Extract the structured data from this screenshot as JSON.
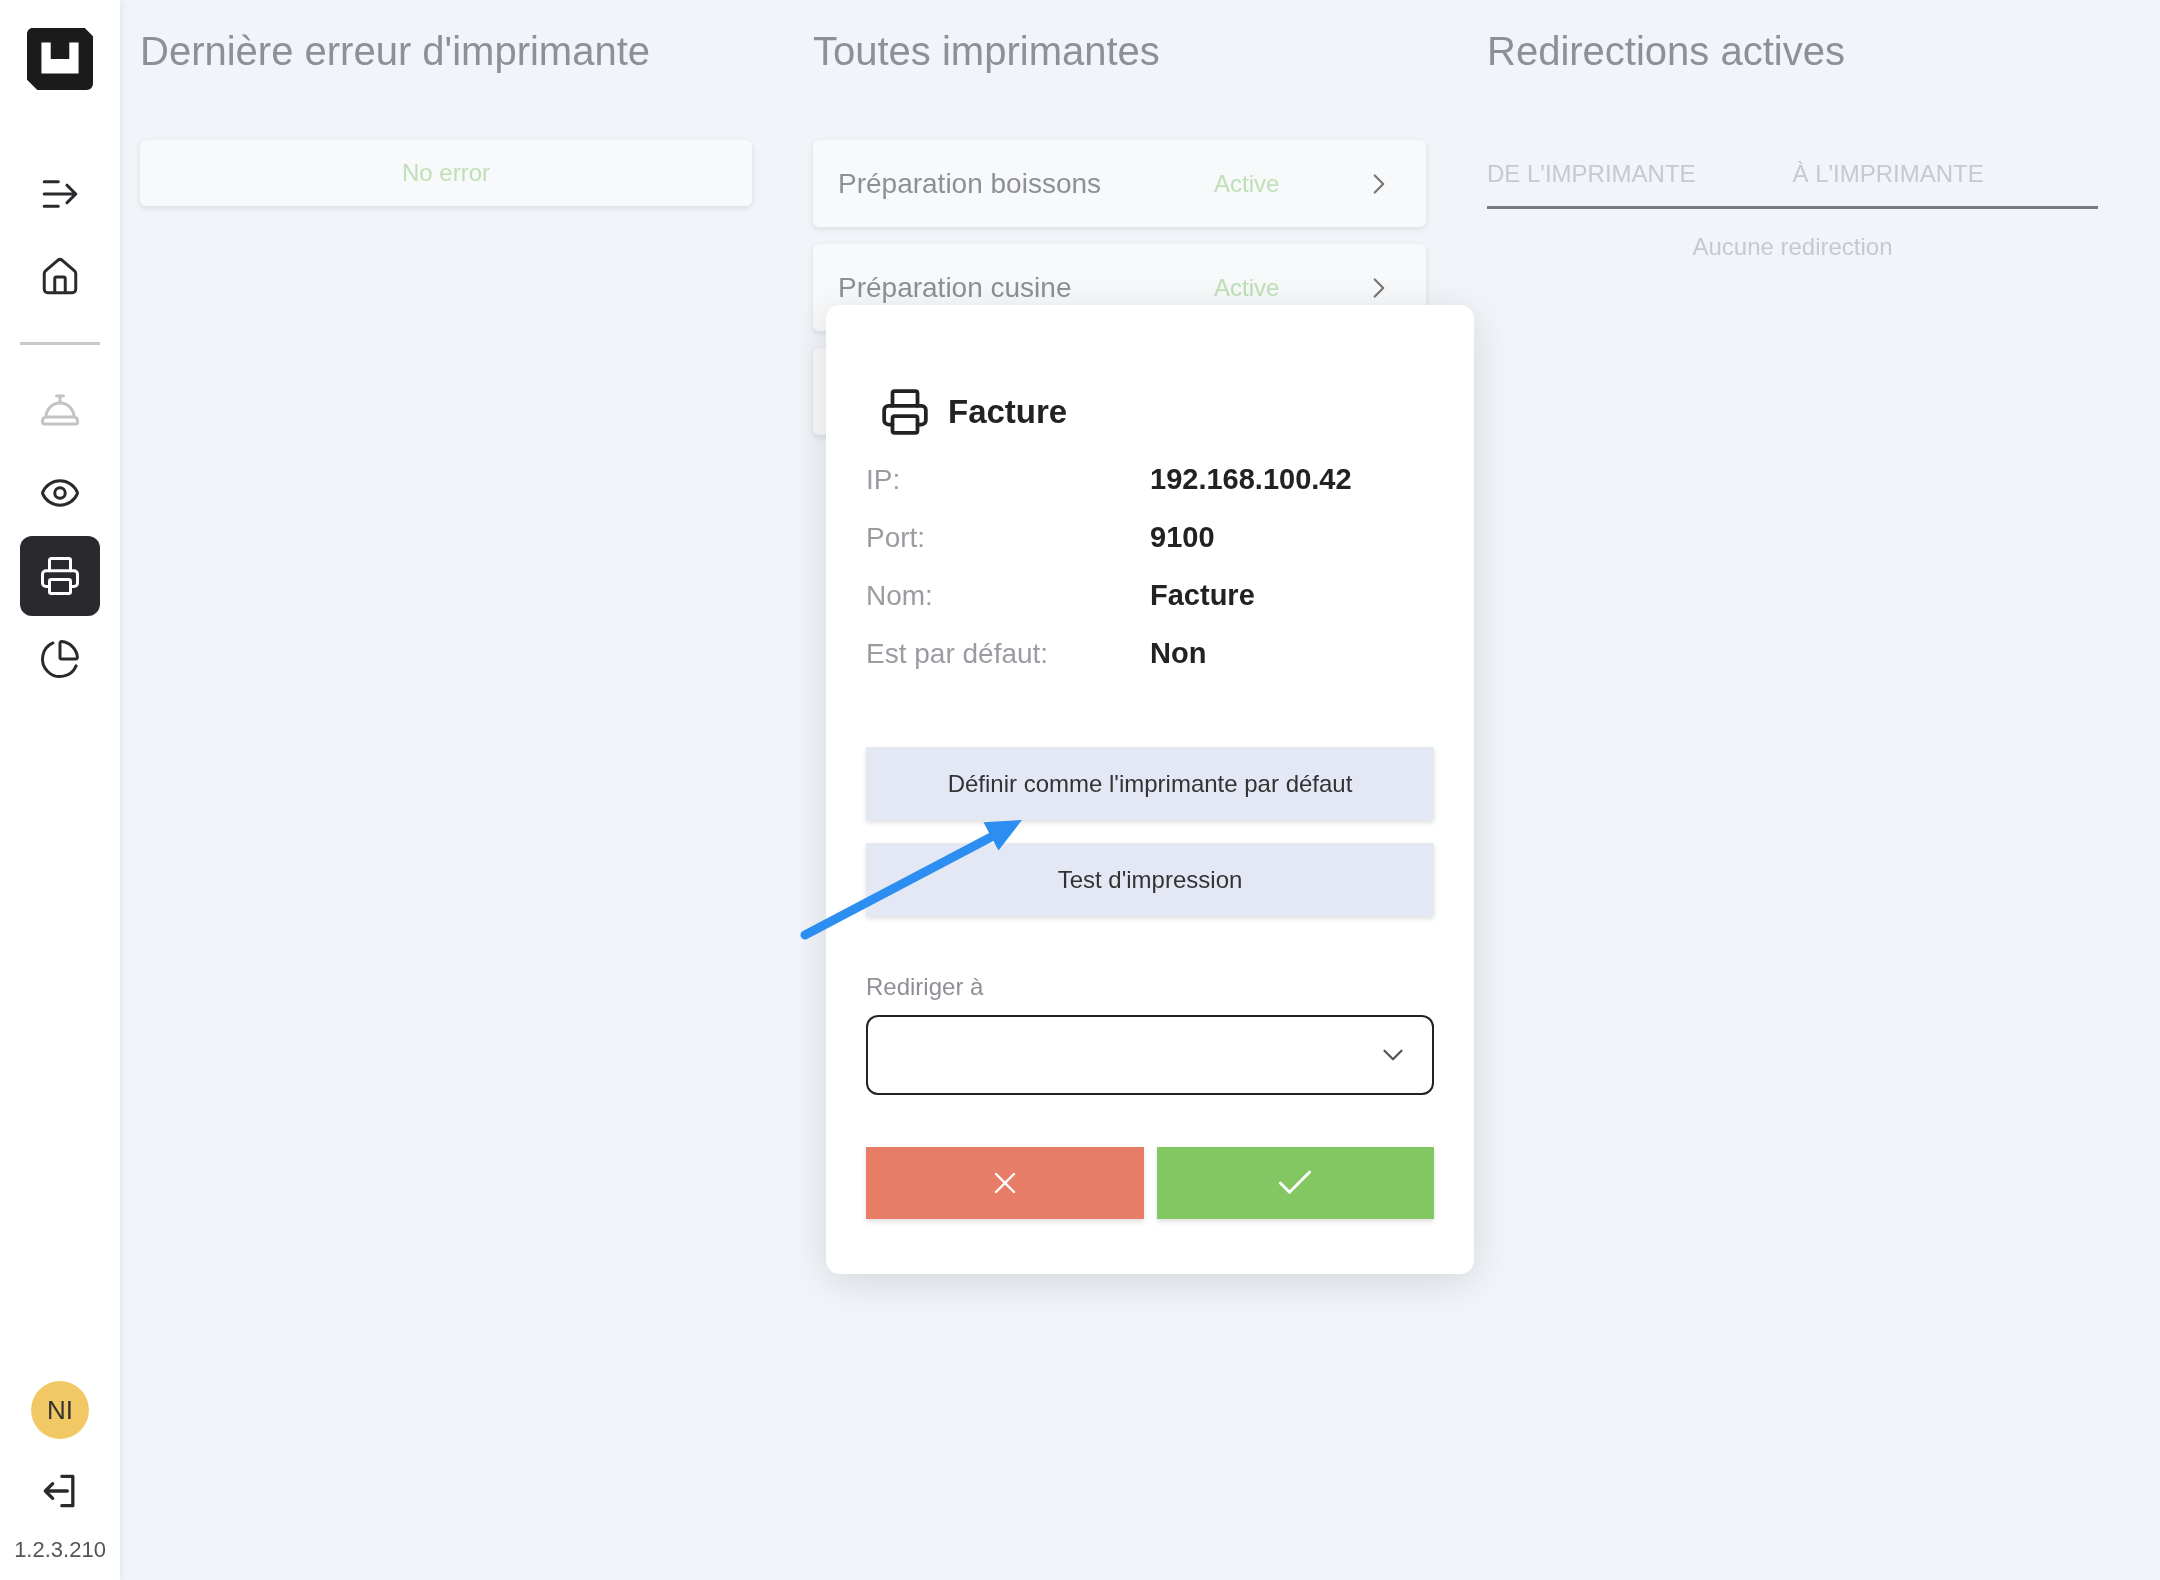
{
  "sidebar": {
    "items": [
      {
        "kind": "menu",
        "selected": false,
        "disabled": false
      },
      {
        "kind": "home",
        "selected": false,
        "disabled": false
      },
      {
        "kind": "bell",
        "selected": false,
        "disabled": true
      },
      {
        "kind": "eye",
        "selected": false,
        "disabled": false
      },
      {
        "kind": "printer",
        "selected": true,
        "disabled": false
      },
      {
        "kind": "chart",
        "selected": false,
        "disabled": false
      }
    ],
    "avatar": {
      "initials": "NI",
      "color": "#f2c864"
    },
    "version": "1.2.3.210"
  },
  "last_error": {
    "title": "Dernière erreur d'imprimante",
    "message": "No error"
  },
  "printers": {
    "title": "Toutes imprimantes",
    "items": [
      {
        "name": "Préparation boissons",
        "status": "Active"
      },
      {
        "name": "Préparation cusine",
        "status": "Active"
      }
    ]
  },
  "redirects": {
    "title": "Redirections actives",
    "columns": [
      "DE L'IMPRIMANTE",
      "À L'IMPRIMANTE"
    ],
    "empty": "Aucune redirection"
  },
  "dialog": {
    "title": "Facture",
    "details": [
      {
        "label": "IP:",
        "value": "192.168.100.42"
      },
      {
        "label": "Port:",
        "value": "9100"
      },
      {
        "label": "Nom:",
        "value": "Facture"
      },
      {
        "label": "Est par défaut:",
        "value": "Non"
      }
    ],
    "actions": [
      "Définir comme l'imprimante par défaut",
      "Test d'impression"
    ],
    "redirect": {
      "label": "Rediriger à"
    },
    "buttons": [
      {
        "kind": "cancel"
      },
      {
        "kind": "confirm"
      }
    ]
  }
}
